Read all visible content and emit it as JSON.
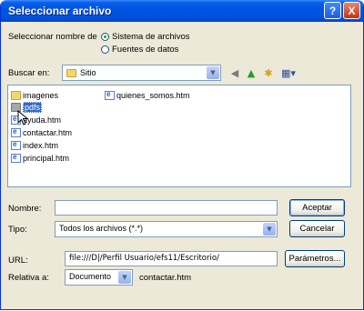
{
  "window": {
    "title": "Seleccionar archivo",
    "help_label": "?",
    "close_label": "X"
  },
  "source": {
    "label": "Seleccionar nombre de",
    "options": [
      {
        "label": "Sistema de archivos",
        "checked": true
      },
      {
        "label": "Fuentes de datos",
        "checked": false
      }
    ]
  },
  "lookin": {
    "label": "Buscar en:",
    "value": "Sitio"
  },
  "toolbar": {
    "icons": [
      "back-icon",
      "up-folder-icon",
      "new-folder-icon",
      "view-menu-icon"
    ]
  },
  "files": [
    {
      "name": "imagenes",
      "type": "folder"
    },
    {
      "name": "pdfs",
      "type": "folder",
      "selected": true
    },
    {
      "name": "ayuda.htm",
      "type": "htm"
    },
    {
      "name": "contactar.htm",
      "type": "htm"
    },
    {
      "name": "index.htm",
      "type": "htm"
    },
    {
      "name": "principal.htm",
      "type": "htm"
    },
    {
      "name": "quienes_somos.htm",
      "type": "htm"
    }
  ],
  "name_field": {
    "label": "Nombre:",
    "value": ""
  },
  "type_field": {
    "label": "Tipo:",
    "value": "Todos los archivos (*.*)"
  },
  "buttons": {
    "accept": "Aceptar",
    "cancel": "Cancelar",
    "params": "Parámetros..."
  },
  "url": {
    "label": "URL:",
    "value": "file:///D|/Perfil Usuario/efs11/Escritorio/"
  },
  "relative": {
    "label": "Relativa a:",
    "value": "Documento",
    "file": "contactar.htm"
  }
}
